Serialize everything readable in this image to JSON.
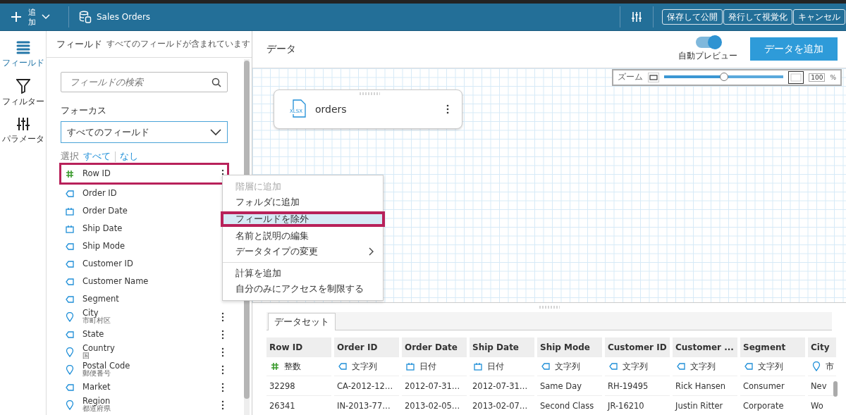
{
  "header": {
    "add_label": "追加",
    "dataset_name": "Sales Orders",
    "buttons": [
      "保存して公開",
      "発行して視覚化",
      "キャンセル"
    ]
  },
  "rail": [
    {
      "label": "フィールド",
      "selected": true
    },
    {
      "label": "フィルター",
      "selected": false
    },
    {
      "label": "パラメータ",
      "selected": false
    }
  ],
  "field_panel": {
    "title": "フィールド",
    "subtitle": "すべてのフィールドが含まれています",
    "search_placeholder": "フィールドの検索",
    "focus_label": "フォーカス",
    "focus_value": "すべてのフィールド",
    "select_label": "選択",
    "select_all": "すべて",
    "select_none": "なし",
    "fields": [
      {
        "name": "Row ID",
        "kind": "number",
        "highlighted": true,
        "menu_button": true
      },
      {
        "name": "Order ID",
        "kind": "string",
        "highlighted": false,
        "menu_button": false
      },
      {
        "name": "Order Date",
        "kind": "date",
        "highlighted": false,
        "menu_button": false
      },
      {
        "name": "Ship Date",
        "kind": "date",
        "highlighted": false,
        "menu_button": false
      },
      {
        "name": "Ship Mode",
        "kind": "string",
        "highlighted": false,
        "menu_button": false
      },
      {
        "name": "Customer ID",
        "kind": "string",
        "highlighted": false,
        "menu_button": false
      },
      {
        "name": "Customer Name",
        "kind": "string",
        "highlighted": false,
        "menu_button": false
      },
      {
        "name": "Segment",
        "kind": "string",
        "highlighted": false,
        "menu_button": false
      },
      {
        "name": "City",
        "sub": "市町村区",
        "kind": "geo",
        "highlighted": false,
        "menu_button": true
      },
      {
        "name": "State",
        "kind": "string",
        "highlighted": false,
        "menu_button": true
      },
      {
        "name": "Country",
        "sub": "国",
        "kind": "geo",
        "highlighted": false,
        "menu_button": true
      },
      {
        "name": "Postal Code",
        "sub": "郵便番号",
        "kind": "geo",
        "highlighted": false,
        "menu_button": true
      },
      {
        "name": "Market",
        "kind": "string",
        "highlighted": false,
        "menu_button": true
      },
      {
        "name": "Region",
        "sub": "都道府県",
        "kind": "geo",
        "highlighted": false,
        "menu_button": true
      }
    ]
  },
  "context_menu": {
    "groups": [
      [
        {
          "label": "階層に追加",
          "disabled": true,
          "selected": false,
          "submenu": false
        },
        {
          "label": "フォルダに追加",
          "disabled": false,
          "selected": false,
          "submenu": false
        },
        {
          "label": "フィールドを除外",
          "disabled": false,
          "selected": true,
          "submenu": false
        },
        {
          "label": "名前と説明の編集",
          "disabled": false,
          "selected": false,
          "submenu": false
        },
        {
          "label": "データタイプの変更",
          "disabled": false,
          "selected": false,
          "submenu": true
        }
      ],
      [
        {
          "label": "計算を追加",
          "disabled": false,
          "selected": false,
          "submenu": false
        },
        {
          "label": "自分のみにアクセスを制限する",
          "disabled": false,
          "selected": false,
          "submenu": false
        }
      ]
    ]
  },
  "data_area": {
    "title": "データ",
    "auto_preview": {
      "label": "自動プレビュー",
      "on": true
    },
    "add_data_button": "データを追加",
    "zoom": {
      "label": "ズーム",
      "level": 0.5,
      "value": "100",
      "unit": "%"
    },
    "node": {
      "badge": "XLSX",
      "name": "orders"
    }
  },
  "dataset": {
    "tab": "データセット",
    "columns": [
      {
        "name": "Row ID",
        "kind": "number",
        "type": "整数"
      },
      {
        "name": "Order ID",
        "kind": "string",
        "type": "文字列"
      },
      {
        "name": "Order Date",
        "kind": "date",
        "type": "日付"
      },
      {
        "name": "Ship Date",
        "kind": "date",
        "type": "日付"
      },
      {
        "name": "Ship Mode",
        "kind": "string",
        "type": "文字列"
      },
      {
        "name": "Customer ID",
        "kind": "string",
        "type": "文字列"
      },
      {
        "name": "Customer ...",
        "kind": "string",
        "type": "文字列"
      },
      {
        "name": "Segment",
        "kind": "string",
        "type": "文字列"
      },
      {
        "name": "City",
        "kind": "geo",
        "type": "市"
      }
    ],
    "rows": [
      [
        "32298",
        "CA-2012-12…",
        "2012-07-31…",
        "2012-07-31…",
        "Same Day",
        "RH-19495",
        "Rick Hansen",
        "Consumer",
        "Nev"
      ],
      [
        "26341",
        "IN-2013-77…",
        "2013-02-05…",
        "2013-02-07…",
        "Second Class",
        "JR-16210",
        "Justin Ritter",
        "Corporate",
        "Wo"
      ]
    ]
  }
}
